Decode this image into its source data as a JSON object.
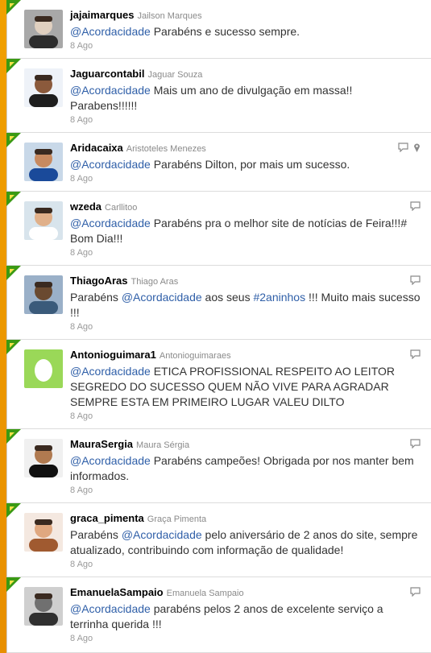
{
  "tweets": [
    {
      "user": "jajaimarques",
      "name": "Jailson Marques",
      "segments": [
        {
          "t": "@Acordacidade",
          "m": true
        },
        {
          "t": " Parabéns e sucesso sempre.",
          "m": false
        }
      ],
      "date": "8 Ago",
      "reply": false,
      "pin": false,
      "h": 73,
      "avatar": "avatar-photo"
    },
    {
      "user": "Jaguarcontabil",
      "name": "Jaguar Souza",
      "segments": [
        {
          "t": "@Acordacidade",
          "m": true
        },
        {
          "t": " Mais um ano de divulgação em massa!! Parabens!!!!!!",
          "m": false
        }
      ],
      "date": "8 Ago",
      "reply": false,
      "pin": false,
      "h": 92,
      "avatar": "avatar-photo"
    },
    {
      "user": "Aridacaixa",
      "name": "Aristoteles Menezes",
      "segments": [
        {
          "t": "@Acordacidade",
          "m": true
        },
        {
          "t": " Parabéns Dilton, por mais um sucesso.",
          "m": false
        }
      ],
      "date": "8 Ago",
      "reply": true,
      "pin": true,
      "h": 73,
      "avatar": "avatar-photo"
    },
    {
      "user": "wzeda",
      "name": "Carllitoo",
      "segments": [
        {
          "t": "@Acordacidade",
          "m": true
        },
        {
          "t": " Parabéns pra o melhor site de notícias de Feira!!!# Bom Dia!!!",
          "m": false
        }
      ],
      "date": "8 Ago",
      "reply": true,
      "pin": false,
      "h": 92,
      "avatar": "avatar-photo"
    },
    {
      "user": "ThiagoAras",
      "name": "Thiago Aras",
      "segments": [
        {
          "t": "Parabéns ",
          "m": false
        },
        {
          "t": "@Acordacidade",
          "m": true
        },
        {
          "t": " aos seus ",
          "m": false
        },
        {
          "t": "#2aninhos",
          "m": true
        },
        {
          "t": " !!! Muito mais sucesso !!!",
          "m": false
        }
      ],
      "date": "8 Ago",
      "reply": true,
      "pin": false,
      "h": 92,
      "avatar": "avatar-photo"
    },
    {
      "user": "Antonioguimara1",
      "name": "Antonioguimaraes",
      "segments": [
        {
          "t": "@Acordacidade",
          "m": true
        },
        {
          "t": " ETICA PROFISSIONAL RESPEITO AO LEITOR SEGREDO DO SUCESSO QUEM NÃO VIVE PARA AGRADAR SEMPRE ESTA EM PRIMEIRO LUGAR VALEU DILTO",
          "m": false
        }
      ],
      "date": "8 Ago",
      "reply": true,
      "pin": false,
      "h": 111,
      "avatar": "egg"
    },
    {
      "user": "MauraSergia",
      "name": "Maura Sérgia",
      "segments": [
        {
          "t": "@Acordacidade",
          "m": true
        },
        {
          "t": " Parabéns campeões! Obrigada por nos manter bem informados.",
          "m": false
        }
      ],
      "date": "8 Ago",
      "reply": true,
      "pin": false,
      "h": 92,
      "avatar": "avatar-photo"
    },
    {
      "user": "graca_pimenta",
      "name": "Graça Pimenta",
      "segments": [
        {
          "t": "Parabéns ",
          "m": false
        },
        {
          "t": "@Acordacidade",
          "m": true
        },
        {
          "t": " pelo aniversário de 2 anos do site, sempre atualizado, contribuindo com informação de qualidade!",
          "m": false
        }
      ],
      "date": "8 Ago",
      "reply": false,
      "pin": false,
      "h": 92,
      "avatar": "avatar-photo"
    },
    {
      "user": "EmanuelaSampaio",
      "name": "Emanuela Sampaio",
      "segments": [
        {
          "t": "@Acordacidade",
          "m": true
        },
        {
          "t": " parabéns pelos 2 anos de excelente serviço a terrinha querida !!!",
          "m": false
        }
      ],
      "date": "8 Ago",
      "reply": true,
      "pin": false,
      "h": 94,
      "avatar": "avatar-photo"
    }
  ],
  "colors": {
    "mention": "#2f5fa8",
    "rail": "#f0a000",
    "corner_green": "#3a9a14"
  }
}
